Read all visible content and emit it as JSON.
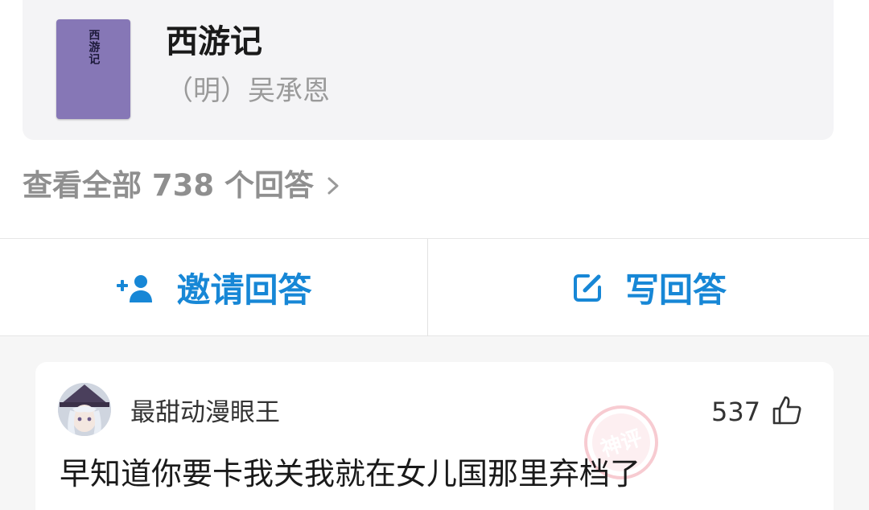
{
  "book": {
    "cover_text": "西游记",
    "title": "西游记",
    "author": "（明）吴承恩"
  },
  "view_all": {
    "label": "查看全部 738 个回答",
    "chevron_icon": "chevron-right-icon"
  },
  "actions": {
    "invite_label": "邀请回答",
    "invite_icon": "add-person-icon",
    "write_label": "写回答",
    "write_icon": "edit-icon"
  },
  "answer": {
    "username": "最甜动漫眼王",
    "likes": "537",
    "like_icon": "thumbs-up-icon",
    "text": "早知道你要卡我关我就在女儿国那里弃档了",
    "stamp_text": "神评"
  },
  "colors": {
    "accent": "#1787d6",
    "cover": "#8677b6",
    "muted_text": "#8f8f8f",
    "stamp": "#f2a2ad"
  }
}
